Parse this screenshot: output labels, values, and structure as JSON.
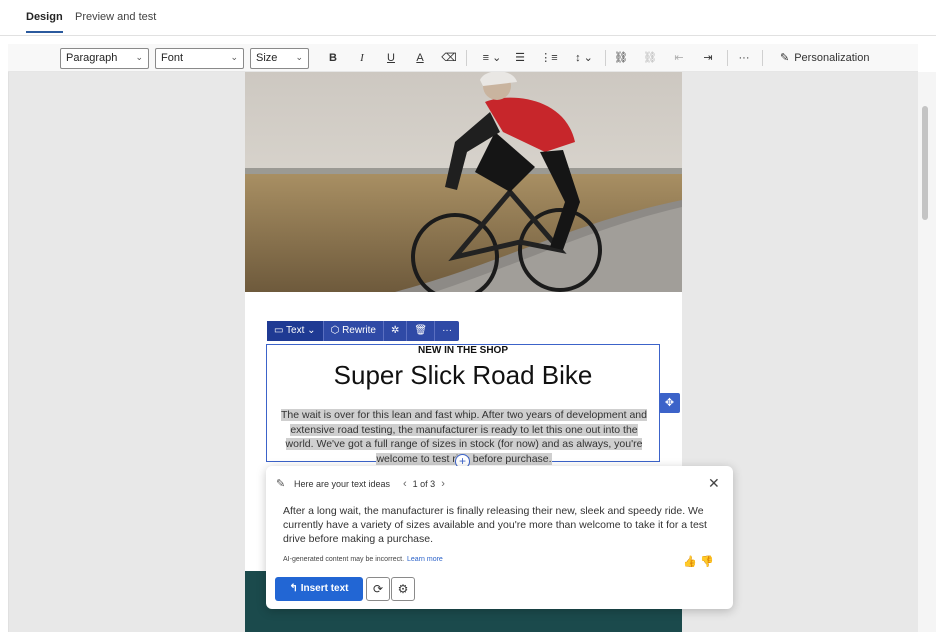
{
  "tabs": {
    "design": "Design",
    "preview": "Preview and test"
  },
  "toolbar": {
    "paragraph": "Paragraph",
    "font": "Font",
    "size": "Size",
    "bold": "B",
    "italic": "I",
    "underline": "U",
    "font_color": "A",
    "more": "···",
    "personalization": "Personalization"
  },
  "block_toolbar": {
    "text_label": "Text",
    "rewrite_label": "Rewrite",
    "more": "···"
  },
  "email": {
    "eyebrow": "NEW IN THE SHOP",
    "headline": "Super Slick Road Bike",
    "body": "The wait is over for this lean and fast whip. After two years of development and extensive road testing, the manufacturer is ready to let this one out into the world. We've got a full range of sizes in stock (for now) and as always, you're welcome to test ride before purchase."
  },
  "ideas": {
    "header": "Here are your text ideas",
    "page": "1 of 3",
    "suggestion": "After a long wait, the manufacturer is finally releasing their new, sleek and speedy ride. We currently have a variety of sizes available and you're more than welcome to take it for a test drive before making a purchase.",
    "disclaimer": "AI-generated content may be incorrect.",
    "learn_more": "Learn more",
    "insert_label": "Insert text"
  },
  "colors": {
    "accent": "#2266d4",
    "selection": "#3c63c9",
    "block_toolbar": "#2f4aa6",
    "footer_band": "#1b4a4c"
  }
}
